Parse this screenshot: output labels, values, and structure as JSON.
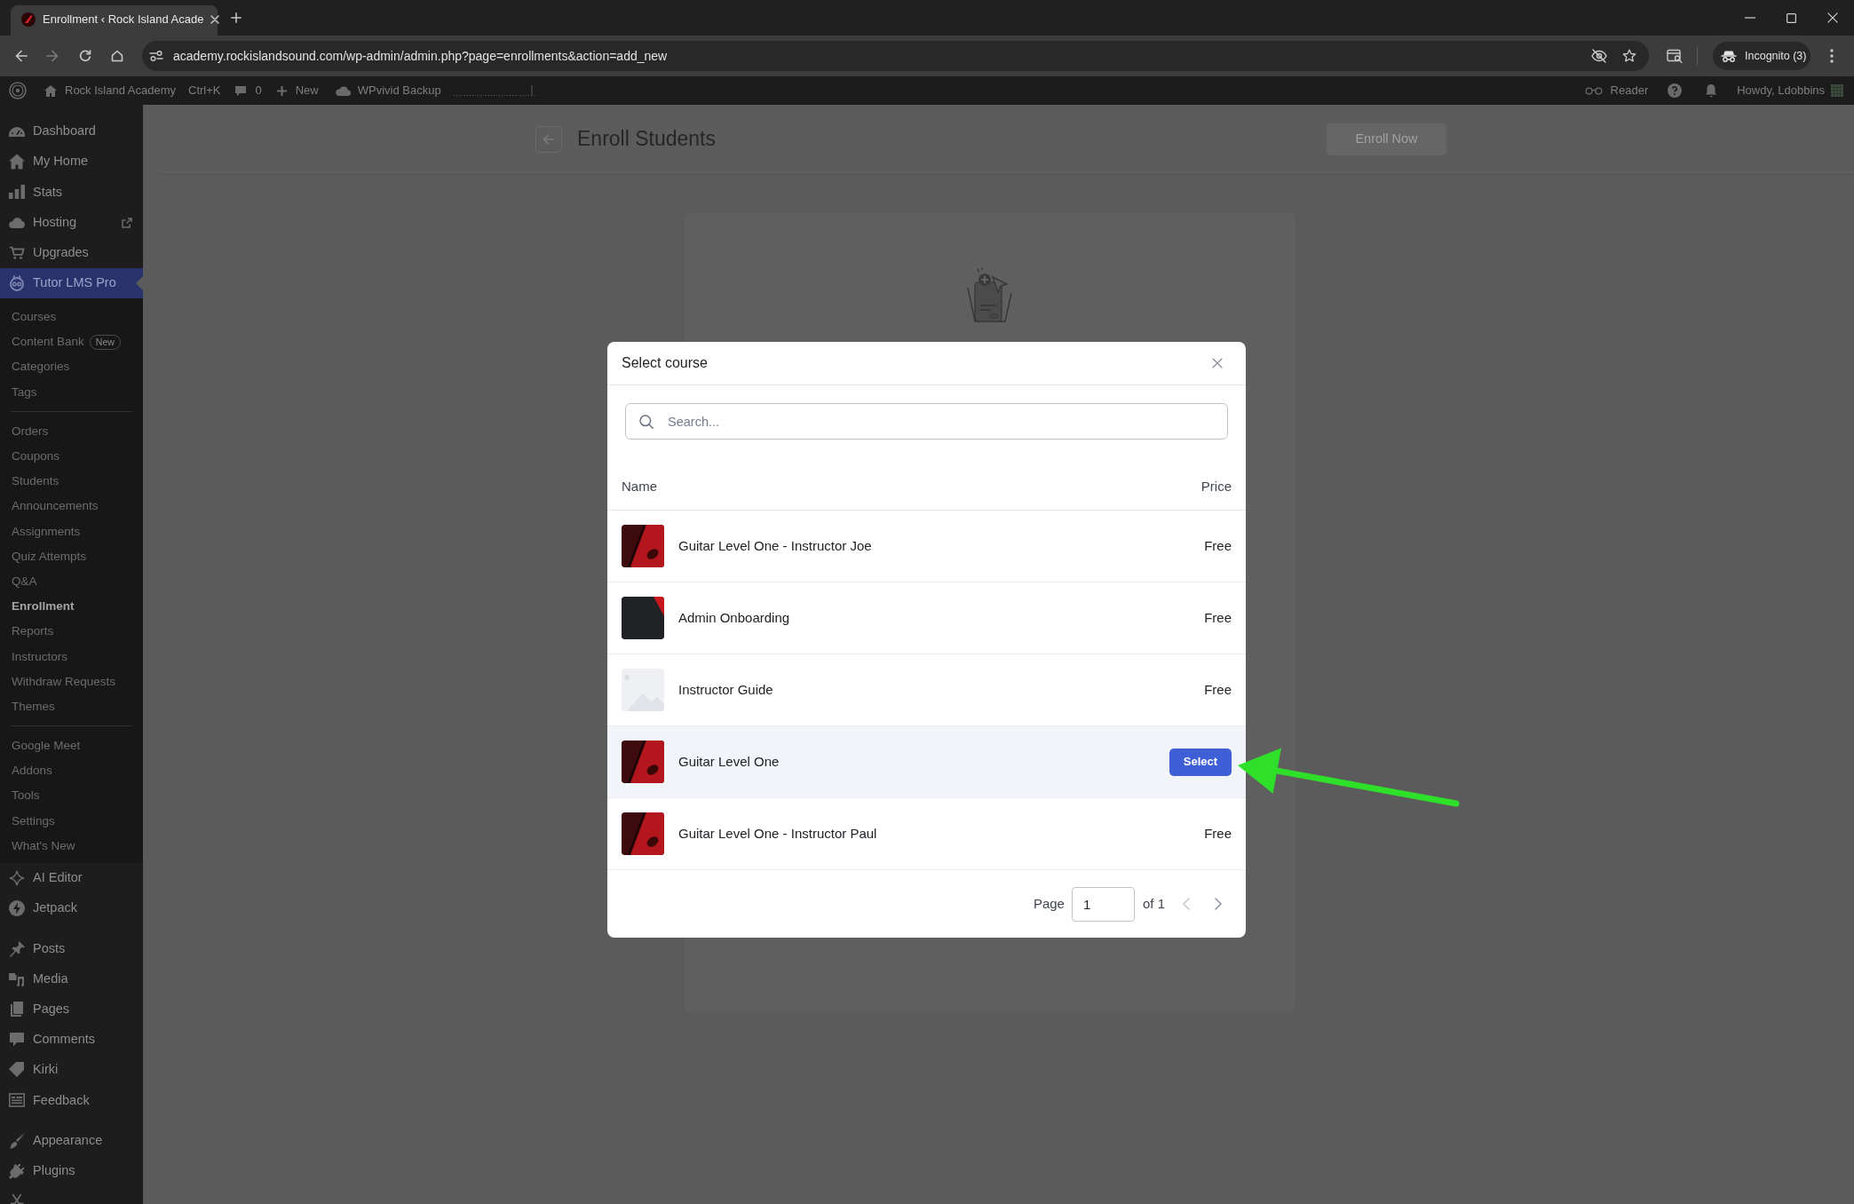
{
  "browser": {
    "tab_title": "Enrollment ‹ Rock Island Acade",
    "url": "academy.rockislandsound.com/wp-admin/admin.php?page=enrollments&action=add_new",
    "profile": "Incognito (3)"
  },
  "admin_bar": {
    "site_name": "Rock Island Academy",
    "shortcut": "Ctrl+K",
    "comment_count": "0",
    "new_label": "New",
    "backup_label": "WPvivid Backup",
    "reader_label": "Reader",
    "greeting": "Howdy, Ldobbins"
  },
  "sidebar": {
    "menu_groups": [
      {
        "items": [
          {
            "label": "Dashboard",
            "selected": false
          },
          {
            "label": "My Home",
            "selected": false
          },
          {
            "label": "Stats",
            "selected": false
          },
          {
            "label": "Hosting",
            "selected": false
          },
          {
            "label": "Upgrades",
            "selected": false
          },
          {
            "label": "Tutor LMS Pro",
            "selected": true,
            "submenu": [
              {
                "items": [
                  {
                    "label": "Courses",
                    "selected": false
                  },
                  {
                    "label": "Content Bank",
                    "badge": "New",
                    "selected": false
                  },
                  {
                    "label": "Categories",
                    "selected": false
                  },
                  {
                    "label": "Tags",
                    "selected": false
                  }
                ]
              },
              {
                "items": [
                  {
                    "label": "Orders",
                    "selected": false
                  },
                  {
                    "label": "Coupons",
                    "selected": false
                  },
                  {
                    "label": "Students",
                    "selected": false
                  },
                  {
                    "label": "Announcements",
                    "selected": false
                  },
                  {
                    "label": "Assignments",
                    "selected": false
                  },
                  {
                    "label": "Quiz Attempts",
                    "selected": false
                  },
                  {
                    "label": "Q&A",
                    "selected": false
                  },
                  {
                    "label": "Enrollment",
                    "selected": true
                  },
                  {
                    "label": "Reports",
                    "selected": false
                  },
                  {
                    "label": "Instructors",
                    "selected": false
                  },
                  {
                    "label": "Withdraw Requests",
                    "selected": false
                  },
                  {
                    "label": "Themes",
                    "selected": false
                  }
                ]
              },
              {
                "items": [
                  {
                    "label": "Google Meet",
                    "selected": false
                  },
                  {
                    "label": "Addons",
                    "selected": false
                  },
                  {
                    "label": "Tools",
                    "selected": false
                  },
                  {
                    "label": "Settings",
                    "selected": false
                  },
                  {
                    "label": "What's New",
                    "selected": false
                  }
                ]
              }
            ]
          },
          {
            "label": "AI Editor",
            "selected": false
          },
          {
            "label": "Jetpack",
            "selected": false
          }
        ]
      },
      {
        "items": [
          {
            "label": "Posts",
            "selected": false
          },
          {
            "label": "Media",
            "selected": false
          },
          {
            "label": "Pages",
            "selected": false
          },
          {
            "label": "Comments",
            "selected": false
          },
          {
            "label": "Kirki",
            "selected": false
          },
          {
            "label": "Feedback",
            "selected": false
          }
        ]
      },
      {
        "items": [
          {
            "label": "Appearance",
            "selected": false
          },
          {
            "label": "Plugins",
            "selected": false
          },
          {
            "selected": false
          }
        ]
      }
    ]
  },
  "page": {
    "title": "Enroll Students",
    "action_button": "Enroll Now"
  },
  "modal": {
    "title": "Select course",
    "search": {
      "placeholder": "Search..."
    },
    "table": {
      "columns": [
        "Name",
        "Price"
      ],
      "row_button": "Select",
      "rows": [
        {
          "kind": "guitar",
          "name": "Guitar Level One - Instructor Joe",
          "price": "Free",
          "hovered": false
        },
        {
          "kind": "onboarding",
          "name": "Admin Onboarding",
          "price": "Free",
          "hovered": false
        },
        {
          "kind": "placeholder",
          "name": "Instructor Guide",
          "price": "Free",
          "hovered": false
        },
        {
          "kind": "guitar",
          "name": "Guitar Level One",
          "hovered": true
        },
        {
          "kind": "guitar",
          "name": "Guitar Level One - Instructor Paul",
          "price": "Free",
          "hovered": false
        }
      ]
    },
    "pagination": {
      "label": "Page",
      "value": "1",
      "total": "of 1"
    }
  }
}
